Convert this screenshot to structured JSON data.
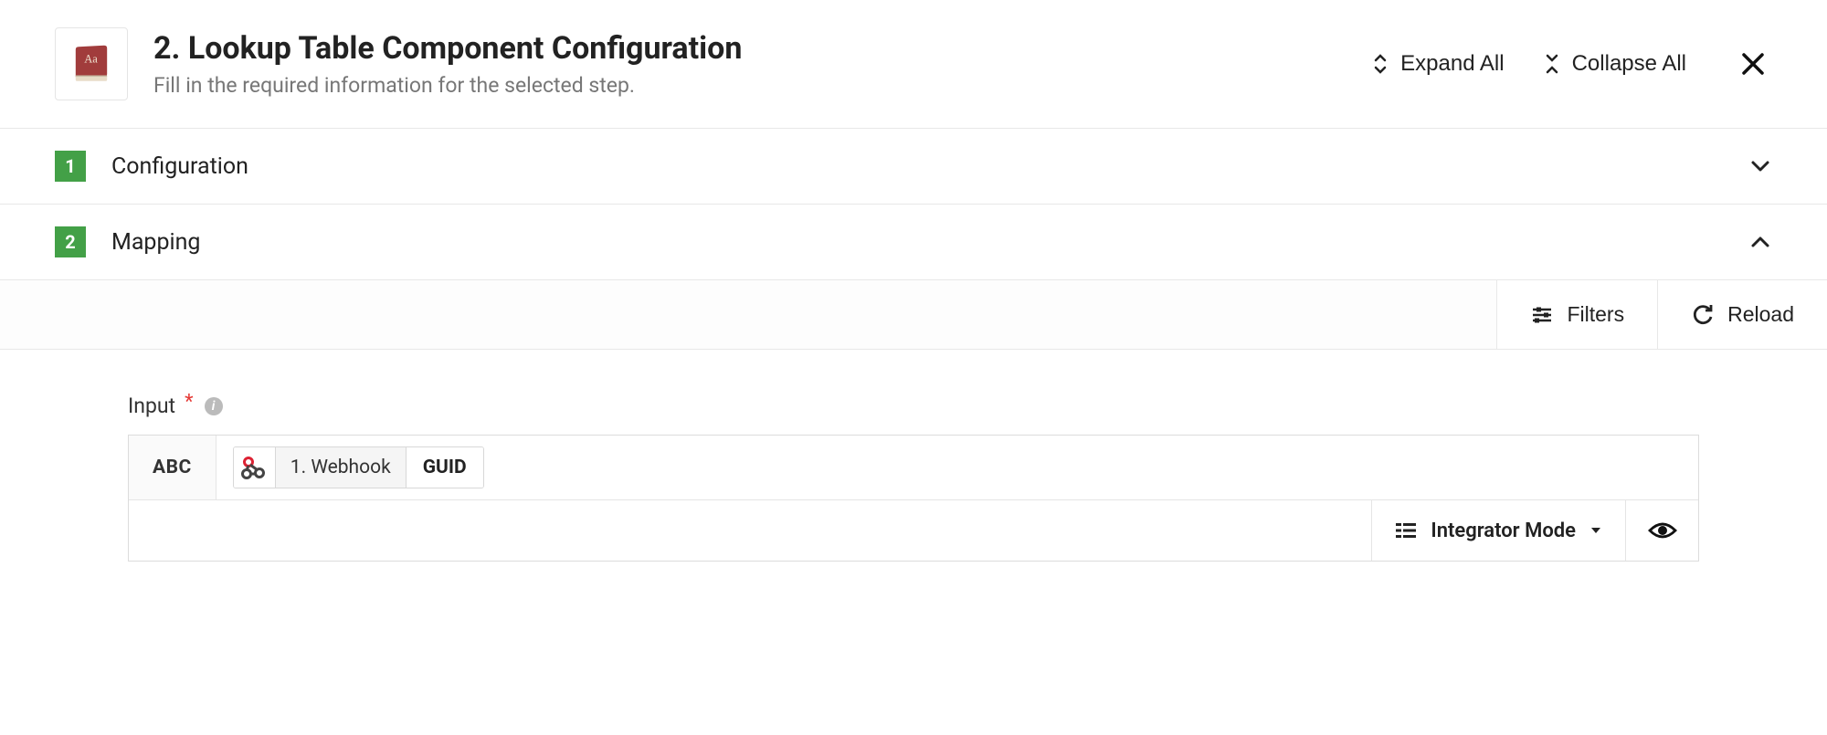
{
  "header": {
    "title": "2. Lookup Table Component Configuration",
    "subtitle": "Fill in the required information for the selected step.",
    "expand_all_label": "Expand All",
    "collapse_all_label": "Collapse All"
  },
  "sections": [
    {
      "number": "1",
      "title": "Configuration",
      "expanded": false
    },
    {
      "number": "2",
      "title": "Mapping",
      "expanded": true
    }
  ],
  "toolbar": {
    "filters_label": "Filters",
    "reload_label": "Reload"
  },
  "input": {
    "label": "Input",
    "required": true,
    "type_badge": "ABC",
    "chip": {
      "step_label": "1. Webhook",
      "field_label": "GUID"
    },
    "mode_label": "Integrator Mode"
  }
}
